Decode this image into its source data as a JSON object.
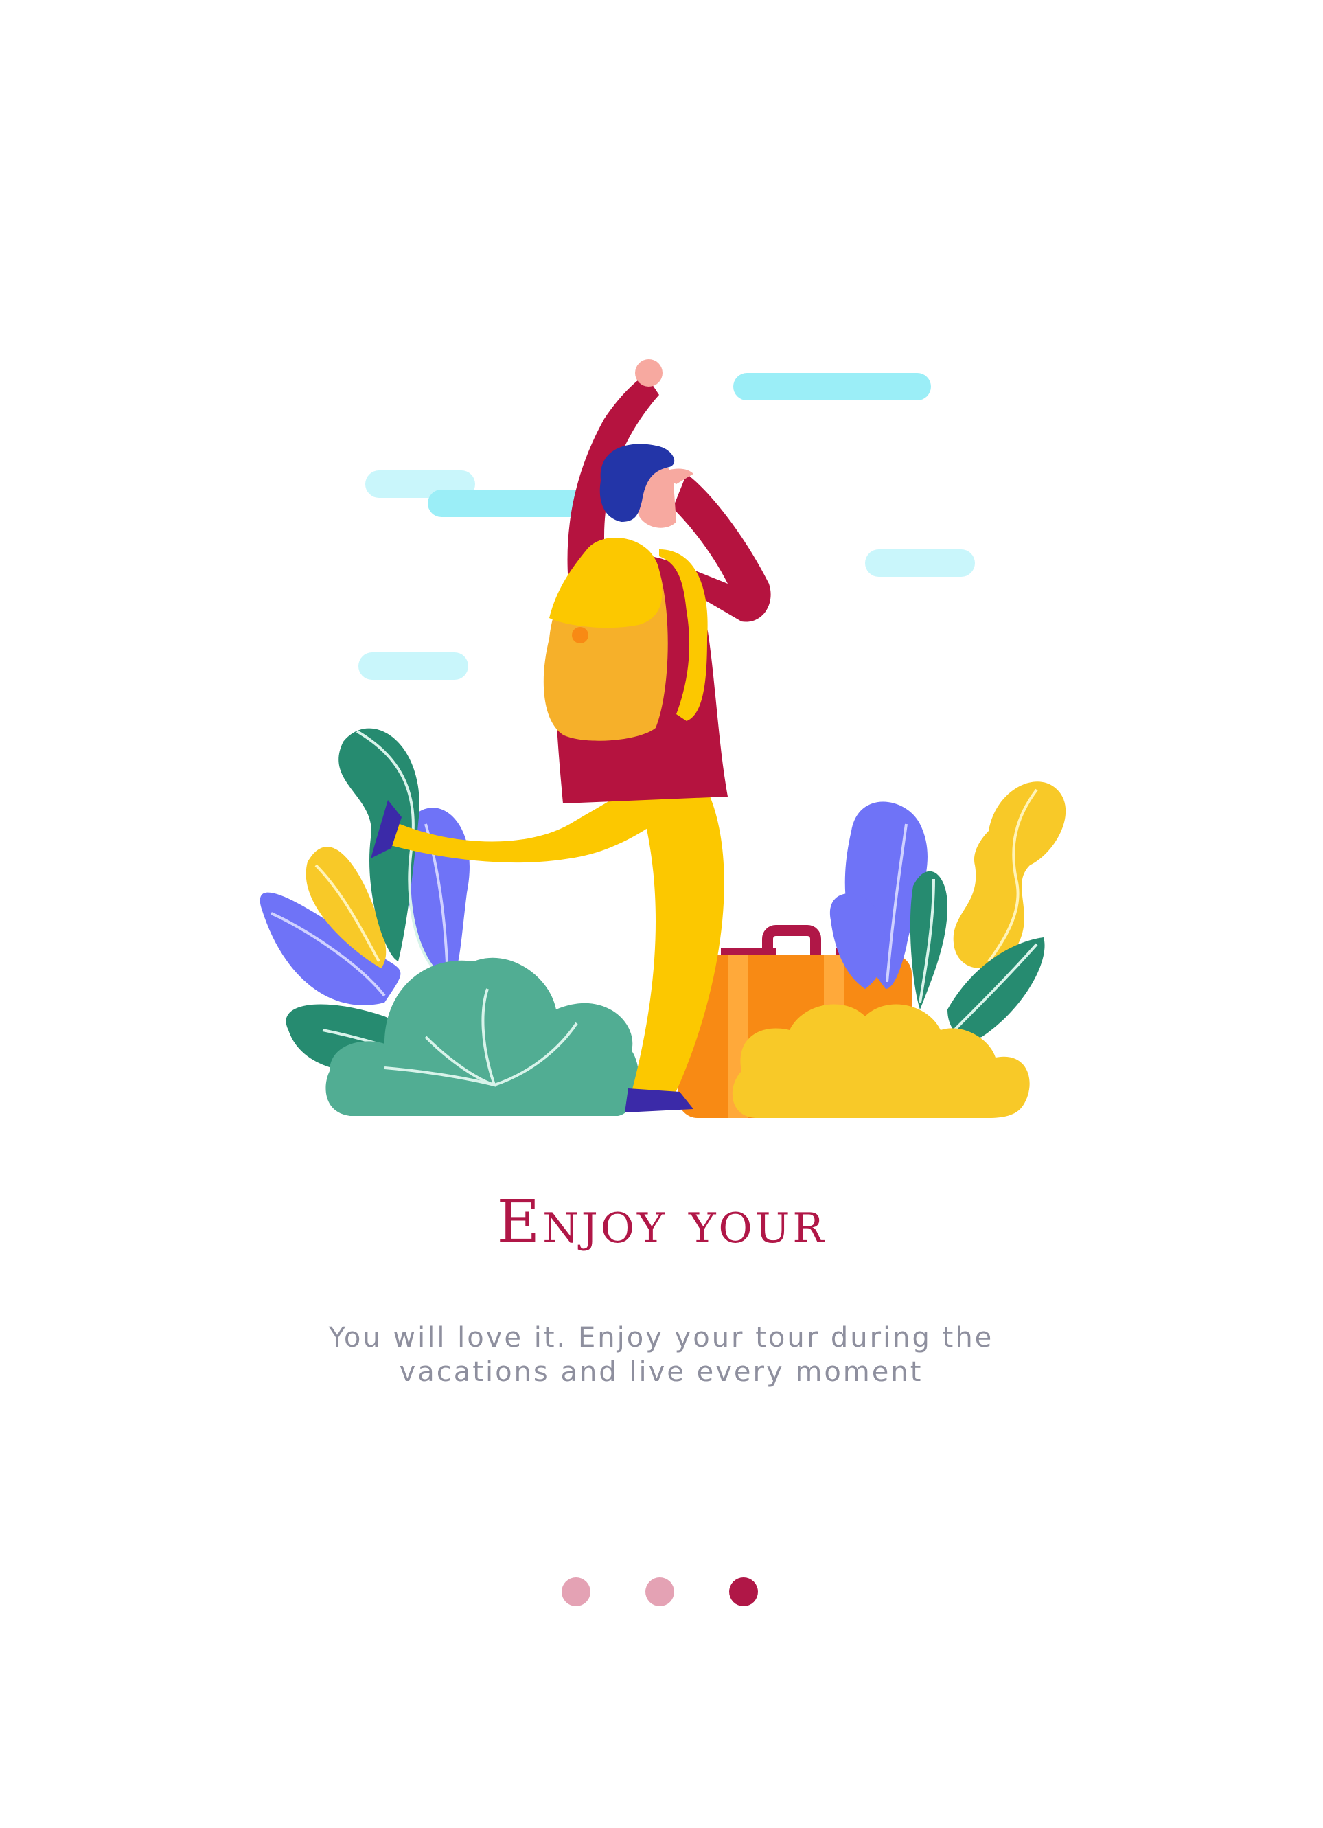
{
  "onboarding": {
    "title": "Enjoy your",
    "subtitle": "You will love it. Enjoy your tour during the vacations and live every moment",
    "pagination": {
      "total": 3,
      "active_index": 2
    }
  },
  "colors": {
    "accent": "#b01747",
    "dot_inactive": "#e4a2b4",
    "subtitle_text": "#8e8f9e"
  },
  "illustration": {
    "icon": "traveler-illustration"
  }
}
